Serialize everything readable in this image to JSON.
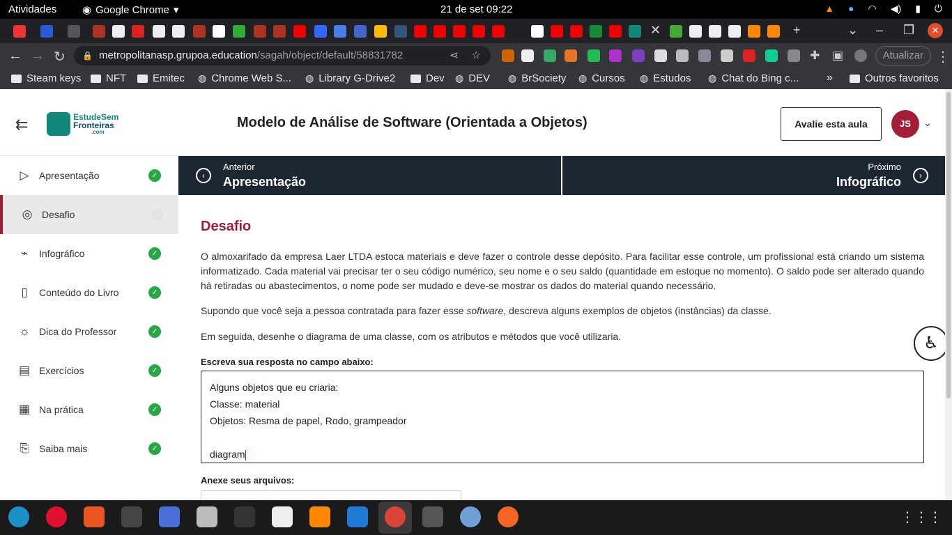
{
  "system": {
    "activities": "Atividades",
    "app_name": "Google Chrome",
    "clock": "21 de set  09:22"
  },
  "browser": {
    "url_host": "metropolitanasp.grupoa.education",
    "url_path": "/sagah/object/default/58831782",
    "update_label": "Atualizar",
    "bookmarks": [
      {
        "label": "Steam keys",
        "icon": "folder-icon"
      },
      {
        "label": "NFT",
        "icon": "folder-icon"
      },
      {
        "label": "Emitec",
        "icon": "folder-icon"
      },
      {
        "label": "Chrome Web S...",
        "icon": "globe-icon"
      },
      {
        "label": "Library G-Drive2",
        "icon": "globe-icon"
      },
      {
        "label": "Dev",
        "icon": "folder-icon"
      },
      {
        "label": "DEV",
        "icon": "drive-icon"
      },
      {
        "label": "BrSociety",
        "icon": "br-icon"
      },
      {
        "label": "Cursos",
        "icon": "cloud-icon"
      },
      {
        "label": "Estudos",
        "icon": "drive-icon"
      },
      {
        "label": "Chat do Bing c...",
        "icon": "search-icon"
      },
      {
        "label": "Outros favoritos",
        "icon": "folder-icon"
      }
    ]
  },
  "header": {
    "logo_line1": "EstudeSem",
    "logo_line2": "Fronteiras",
    "logo_line3": ".com",
    "title": "Modelo de Análise de Software (Orientada a Objetos)",
    "rate_label": "Avalie esta aula",
    "avatar_initials": "JS"
  },
  "sidebar": {
    "items": [
      {
        "label": "Apresentação",
        "icon": "play-square-icon",
        "done": true
      },
      {
        "label": "Desafio",
        "icon": "target-icon",
        "done": false
      },
      {
        "label": "Infográfico",
        "icon": "trend-line-icon",
        "done": true
      },
      {
        "label": "Conteúdo do Livro",
        "icon": "book-icon",
        "done": true
      },
      {
        "label": "Dica do Professor",
        "icon": "lightbulb-icon",
        "done": true
      },
      {
        "label": "Exercícios",
        "icon": "document-icon",
        "done": true
      },
      {
        "label": "Na prática",
        "icon": "clipboard-icon",
        "done": true
      },
      {
        "label": "Saiba mais",
        "icon": "file-plus-icon",
        "done": true
      }
    ]
  },
  "nav": {
    "prev_small": "Anterior",
    "prev_large": "Apresentação",
    "next_small": "Próximo",
    "next_large": "Infográfico"
  },
  "main": {
    "heading": "Desafio",
    "para1": "O almoxarifado da empresa Laer LTDA estoca materiais e deve fazer o controle desse depósito. Para facilitar esse controle, um profissional está criando um sistema informatizado. Cada material vai precisar ter o seu código numérico, seu nome e o seu saldo (quantidade em estoque no momento). O saldo pode ser alterado quando há retiradas ou abastecimentos, o nome pode ser mudado e deve-se mostrar os dados do material quando necessário.",
    "para2_before": "Supondo que você seja a pessoa contratada para fazer esse ",
    "para2_italic": "software",
    "para2_after": ", descreva alguns exemplos de objetos (instâncias) da classe.",
    "para3": "Em seguida, desenhe o diagrama de uma classe, com os atributos e métodos que você utilizaria.",
    "answer_label": "Escreva sua resposta no campo abaixo:",
    "answer_lines": [
      "Alguns objetos que eu criaria:",
      "Classe: material",
      "Objetos: Resma de papel, Rodo, grampeador",
      "",
      "diagram"
    ],
    "attach_label": "Anexe seus arquivos:"
  },
  "colors": {
    "accent": "#a31d36",
    "nav_bg": "#1c2731",
    "check_green": "#27a745"
  }
}
